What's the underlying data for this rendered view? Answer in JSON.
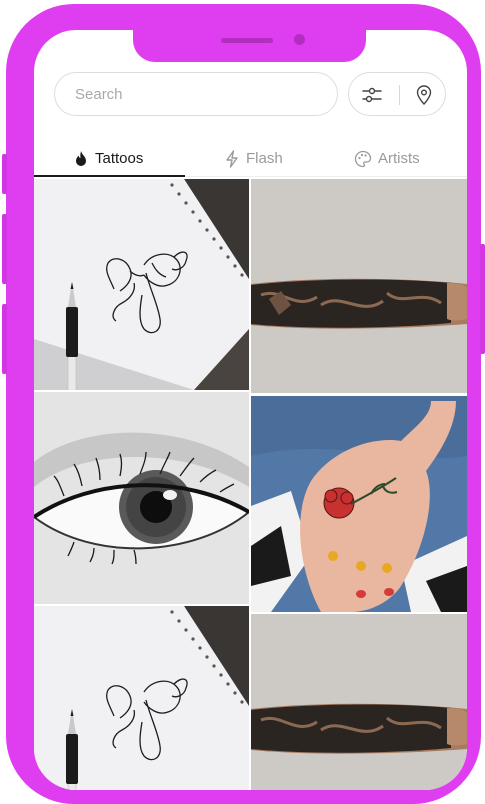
{
  "search": {
    "placeholder": "Search"
  },
  "tools": {
    "filter_icon": "sliders-icon",
    "location_icon": "map-pin-icon"
  },
  "tabs": [
    {
      "label": "Tattoos",
      "icon": "flame-icon",
      "active": true
    },
    {
      "label": "Flash",
      "icon": "lightning-icon",
      "active": false
    },
    {
      "label": "Artists",
      "icon": "palette-icon",
      "active": false
    }
  ],
  "colors": {
    "frame": "#df3df0",
    "accent_text": "#1a1a1a",
    "muted_text": "#9a9a9a"
  }
}
